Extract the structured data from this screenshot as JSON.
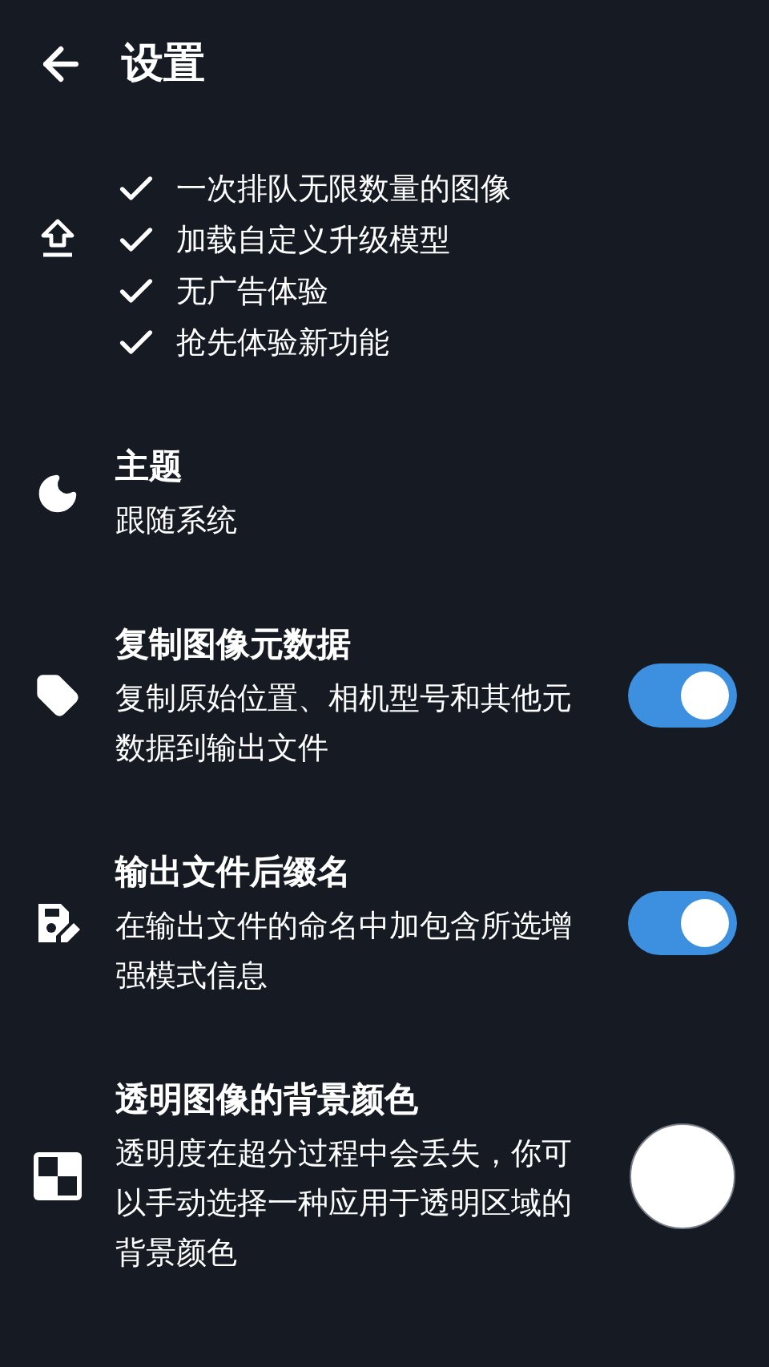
{
  "header": {
    "title": "设置"
  },
  "pro_features": [
    "一次排队无限数量的图像",
    "加载自定义升级模型",
    "无广告体验",
    "抢先体验新功能"
  ],
  "settings": [
    {
      "kind": "text",
      "title": "主题",
      "description": "跟随系统"
    },
    {
      "kind": "toggle",
      "title": "复制图像元数据",
      "description": "复制原始位置、相机型号和其他元数据到输出文件",
      "on": true
    },
    {
      "kind": "toggle",
      "title": "输出文件后缀名",
      "description": "在输出文件的命名中加包含所选增强模式信息",
      "on": true
    },
    {
      "kind": "color",
      "title": "透明图像的背景颜色",
      "description": "透明度在超分过程中会丢失，你可以手动选择一种应用于透明区域的背景颜色",
      "color": "#ffffff"
    }
  ]
}
